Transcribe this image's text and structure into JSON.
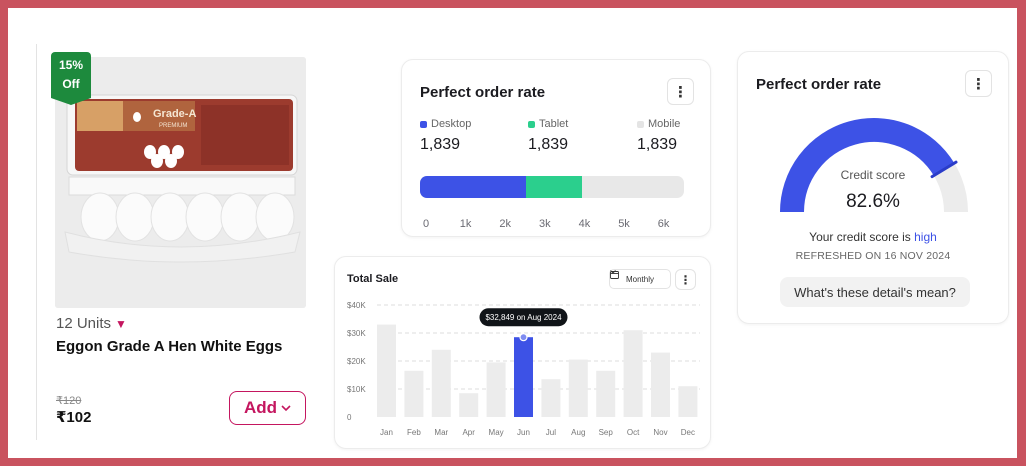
{
  "product": {
    "badge_pct": "15%",
    "badge_off": "Off",
    "box_brand": "EGG ON EGGS",
    "box_grade": "Grade-A",
    "box_sub": "PREMIUM",
    "units": "12 Units",
    "name": "Eggon Grade A Hen White Eggs",
    "old_price": "₹120",
    "price": "₹102",
    "add_label": "Add"
  },
  "order_rate": {
    "title": "Perfect order rate",
    "stats": [
      {
        "label": "Desktop",
        "value": "1,839",
        "color": "#3d52e6"
      },
      {
        "label": "Tablet",
        "value": "1,839",
        "color": "#2bcf8d"
      },
      {
        "label": "Mobile",
        "value": "1,839",
        "color": "#e4e4e4"
      }
    ],
    "bar_values": {
      "desktop": 2.6,
      "tablet": 1.4,
      "max": 6.5
    },
    "axis": [
      "0",
      "1k",
      "2k",
      "3k",
      "4k",
      "5k",
      "6k"
    ]
  },
  "credit": {
    "title": "Perfect order rate",
    "score_label": "Credit score",
    "score_value": "82.6%",
    "gauge_fraction": 0.826,
    "text_prefix": "Your credit score is",
    "text_highlight": "high",
    "refreshed": "REFRESHED ON 16 NOV 2024",
    "detail_button": "What's these detail's mean?",
    "accent": "#3d52e6"
  },
  "total_sale": {
    "title": "Total Sale",
    "period": "Monthly",
    "tooltip": "$32,849 on Aug 2024",
    "highlight_index": 5,
    "accent": "#3d52e6"
  },
  "chart_data": {
    "type": "bar",
    "title": "Total Sale",
    "categories": [
      "Jan",
      "Feb",
      "Mar",
      "Apr",
      "May",
      "Jun",
      "Jul",
      "Aug",
      "Sep",
      "Oct",
      "Nov",
      "Dec"
    ],
    "values": [
      33000,
      16500,
      24000,
      8500,
      19500,
      28500,
      13500,
      20500,
      16500,
      31000,
      23000,
      11000
    ],
    "ylim": [
      0,
      40000
    ],
    "yticks": [
      "0",
      "$10K",
      "$20K",
      "$30K",
      "$40K"
    ],
    "grid": true
  }
}
